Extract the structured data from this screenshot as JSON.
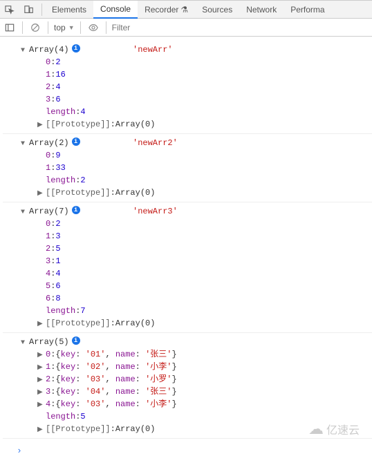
{
  "tabs": {
    "elements": "Elements",
    "console": "Console",
    "recorder": "Recorder",
    "sources": "Sources",
    "network": "Network",
    "performance": "Performa"
  },
  "toolbar": {
    "context": "top",
    "filter_placeholder": "Filter"
  },
  "logs": [
    {
      "header": "Array(4)",
      "label": "'newArr'",
      "items": [
        {
          "idx": "0",
          "val": "2"
        },
        {
          "idx": "1",
          "val": "16"
        },
        {
          "idx": "2",
          "val": "4"
        },
        {
          "idx": "3",
          "val": "6"
        }
      ],
      "length": "4",
      "proto": "Array(0)"
    },
    {
      "header": "Array(2)",
      "label": "'newArr2'",
      "items": [
        {
          "idx": "0",
          "val": "9"
        },
        {
          "idx": "1",
          "val": "33"
        }
      ],
      "length": "2",
      "proto": "Array(0)"
    },
    {
      "header": "Array(7)",
      "label": "'newArr3'",
      "items": [
        {
          "idx": "0",
          "val": "2"
        },
        {
          "idx": "1",
          "val": "3"
        },
        {
          "idx": "2",
          "val": "5"
        },
        {
          "idx": "3",
          "val": "1"
        },
        {
          "idx": "4",
          "val": "4"
        },
        {
          "idx": "5",
          "val": "6"
        },
        {
          "idx": "6",
          "val": "8"
        }
      ],
      "length": "7",
      "proto": "Array(0)"
    }
  ],
  "objlog": {
    "header": "Array(5)",
    "entries": [
      {
        "idx": "0",
        "key": "'01'",
        "name": "'张三'"
      },
      {
        "idx": "1",
        "key": "'02'",
        "name": "'小李'"
      },
      {
        "idx": "2",
        "key": "'03'",
        "name": "'小罗'"
      },
      {
        "idx": "3",
        "key": "'04'",
        "name": "'张三'"
      },
      {
        "idx": "4",
        "key": "'03'",
        "name": "'小李'"
      }
    ],
    "length": "5",
    "proto": "Array(0)"
  },
  "labels": {
    "length": "length",
    "prototype": "[[Prototype]]",
    "key": "key",
    "name": "name"
  },
  "watermark": "亿速云"
}
